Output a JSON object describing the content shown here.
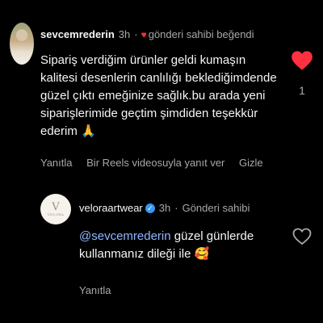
{
  "comment": {
    "username": "sevcemrederin",
    "time": "3h",
    "separator": "·",
    "liked_by_author": "gönderi sahibi beğendi",
    "text": "Sipariş verdiğim ürünler geldi kumaşın kalitesi desenlerin canlılığı beklediğimdende güzel çıktı emeğinize sağlık.bu arada yeni siparişlerimide geçtim şimdiden teşekkür ederim 🙏",
    "like_count": "1",
    "actions": {
      "reply": "Yanıtla",
      "reels_reply": "Bir Reels videosuyla yanıt ver",
      "hide": "Gizle"
    },
    "liked": true,
    "heart_color": "#ff3040"
  },
  "reply": {
    "username": "veloraartwear",
    "avatar_monogram": "V",
    "avatar_brand": "VELORA",
    "time": "3h",
    "separator": "·",
    "author_badge": "Gönderi sahibi",
    "mention": "@sevcemrederin",
    "text": " güzel günlerde kullanmanız dileği ile 🥰",
    "actions": {
      "reply": "Yanıtla"
    },
    "liked": false
  },
  "icons": {
    "comment_heart": "heart-filled-icon",
    "reply_heart": "heart-outline-icon",
    "verified": "verified-badge-icon"
  }
}
